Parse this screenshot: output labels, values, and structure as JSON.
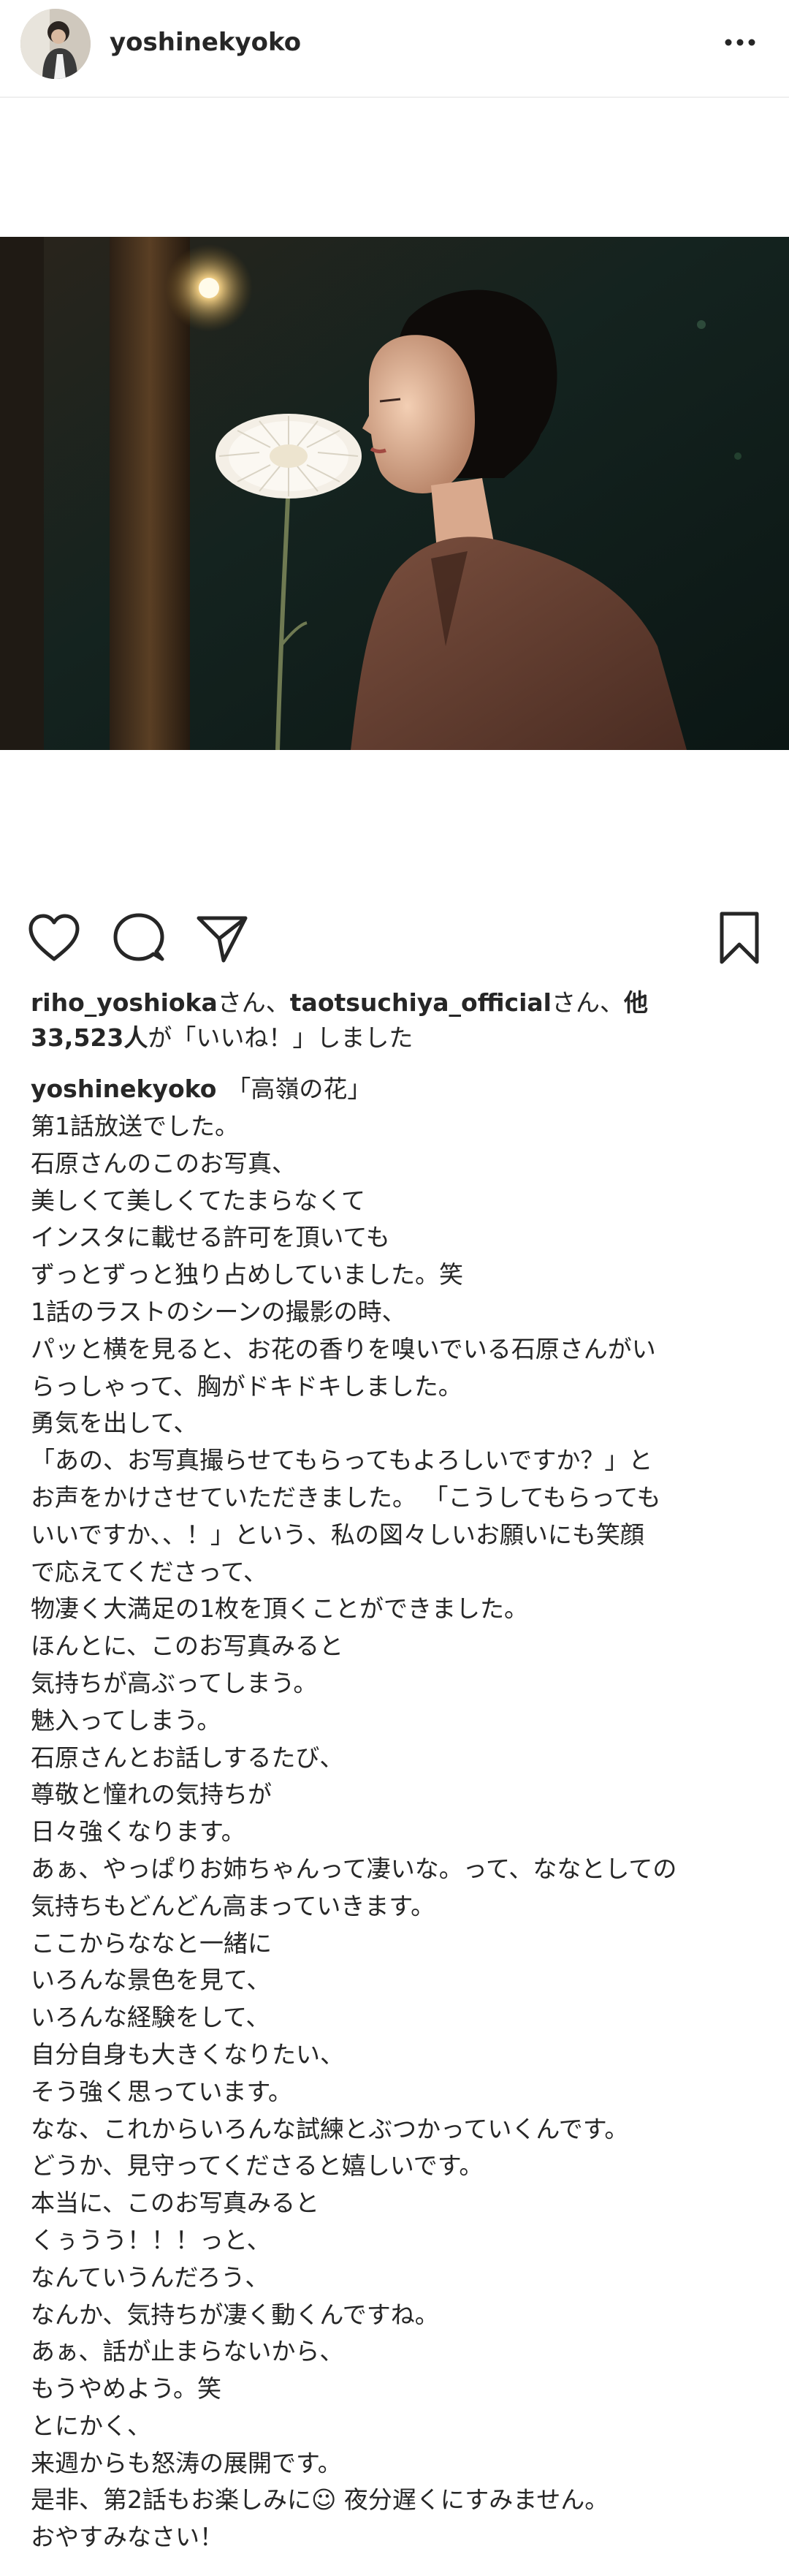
{
  "header": {
    "username": "yoshinekyoko",
    "avatar_icon": "avatar-photo",
    "more_icon": "more-horizontal-icon"
  },
  "post": {
    "photo_description_icon": "post-photo"
  },
  "actions": {
    "like_icon": "heart-icon",
    "comment_icon": "comment-icon",
    "share_icon": "send-icon",
    "save_icon": "bookmark-icon"
  },
  "likes": {
    "user1": "riho_yoshioka",
    "san1": "さん、",
    "user2": "taotsuchiya_official",
    "san2": "さん、",
    "others_count": "他",
    "count_line": "33,523人",
    "suffix": "が「いいね！」しました"
  },
  "caption": {
    "username": "yoshinekyoko",
    "first_line": "「高嶺の花」",
    "lines": [
      "第1話放送でした。",
      "石原さんのこのお写真、",
      "美しくて美しくてたまらなくて",
      "インスタに載せる許可を頂いても",
      "ずっとずっと独り占めしていました。笑",
      "1話のラストのシーンの撮影の時、",
      "パッと横を見ると、お花の香りを嗅いでいる石原さんがい",
      "らっしゃって、胸がドキドキしました。",
      "勇気を出して、",
      "「あの、お写真撮らせてもらってもよろしいですか？」と",
      "お声をかけさせていただきました。 「こうしてもらっても",
      "いいですか、、！」という、私の図々しいお願いにも笑顔",
      "で応えてくださって、",
      "物凄く大満足の1枚を頂くことができました。",
      "ほんとに、このお写真みると",
      "気持ちが高ぶってしまう。",
      "魅入ってしまう。",
      "石原さんとお話しするたび、",
      "尊敬と憧れの気持ちが",
      "日々強くなります。",
      "あぁ、やっぱりお姉ちゃんって凄いな。って、ななとしての",
      "気持ちもどんどん高まっていきます。",
      "ここからななと一緒に",
      "いろんな景色を見て、",
      "いろんな経験をして、",
      "自分自身も大きくなりたい、",
      "そう強く思っています。",
      "なな、これからいろんな試練とぶつかっていくんです。",
      "どうか、見守ってくださると嬉しいです。",
      "本当に、このお写真みると",
      "くぅうう！！！っと、",
      "なんていうんだろう、",
      "なんか、気持ちが凄く動くんですね。",
      "あぁ、話が止まらないから、",
      "もうやめよう。笑",
      "とにかく、",
      "来週からも怒涛の展開です。",
      "是非、第2話もお楽しみに☺︎ 夜分遅くにすみません。",
      "おやすみなさい！"
    ]
  }
}
